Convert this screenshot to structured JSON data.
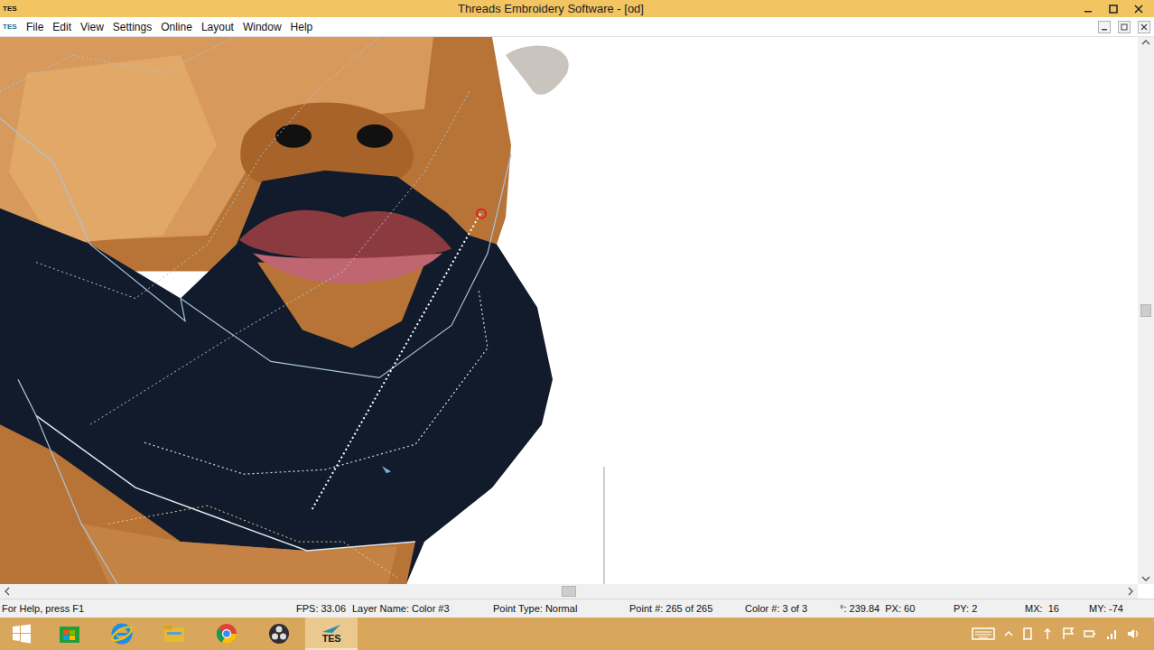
{
  "window": {
    "title": "Threads Embroidery Software - [od]"
  },
  "app_icon": {
    "label": "TES"
  },
  "menu": [
    "File",
    "Edit",
    "View",
    "Settings",
    "Online",
    "Layout",
    "Window",
    "Help"
  ],
  "status_bar": {
    "help": "For Help, press F1",
    "fields": [
      "FPS: 33.06",
      "Layer Name: Color #3",
      "Point Type: Normal",
      "Point #: 265 of 265",
      "Color #: 3 of 3",
      "°: 239.84  PX: 60",
      "PY: 2",
      "MX:  16",
      "MY: -74"
    ]
  },
  "taskbar": {
    "apps": [
      {
        "kind": "store",
        "label": "",
        "selected": false
      },
      {
        "kind": "ie",
        "label": "",
        "selected": false
      },
      {
        "kind": "explorer",
        "label": "",
        "selected": false
      },
      {
        "kind": "chrome",
        "label": "",
        "selected": false
      },
      {
        "kind": "obs",
        "label": "",
        "selected": false
      },
      {
        "kind": "tes",
        "label": "TES",
        "selected": true
      }
    ]
  }
}
